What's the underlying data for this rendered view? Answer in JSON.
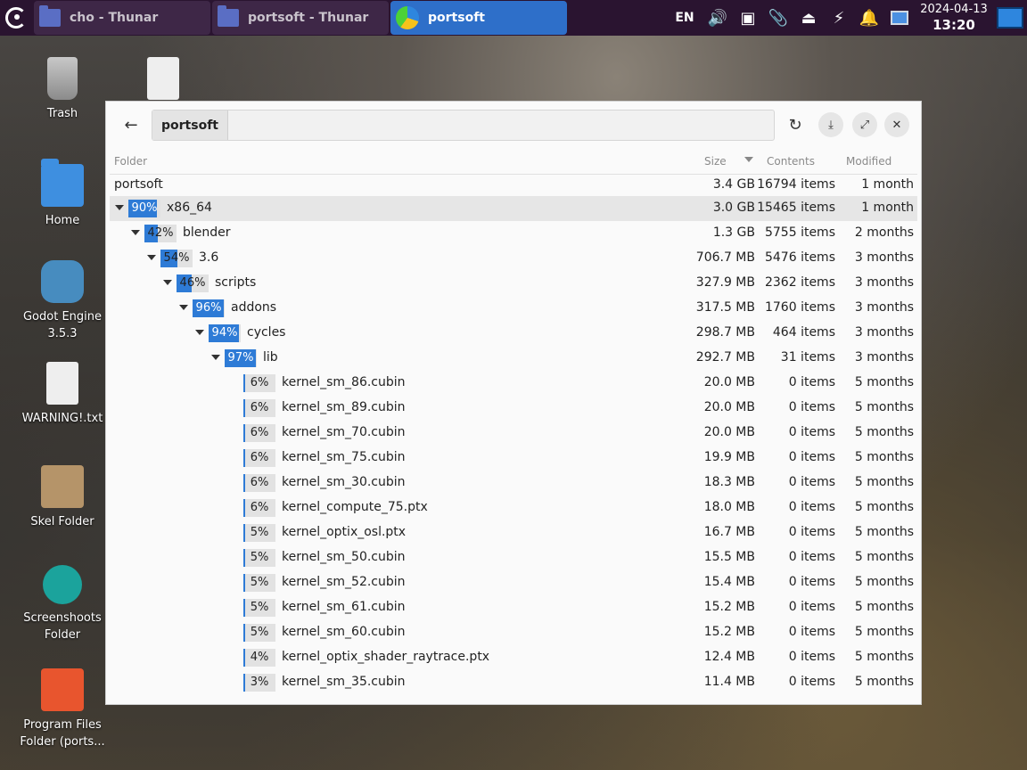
{
  "panel": {
    "tasks": [
      {
        "label": "cho - Thunar"
      },
      {
        "label": "portsoft - Thunar"
      },
      {
        "label": "portsoft"
      }
    ],
    "tray": {
      "language": "EN",
      "date": "2024-04-13",
      "time": "13:20"
    }
  },
  "desktop": {
    "icons": [
      {
        "label": "Trash"
      },
      {
        "label": "Home"
      },
      {
        "label": "Godot Engine 3.5.3"
      },
      {
        "label": "WARNING!.txt"
      },
      {
        "label": "Skel Folder"
      },
      {
        "label": "Screenshoots Folder"
      },
      {
        "label": "Program Files Folder (ports..."
      }
    ]
  },
  "window": {
    "path": "portsoft",
    "columns": {
      "folder": "Folder",
      "size": "Size",
      "contents": "Contents",
      "modified": "Modified"
    },
    "rows": [
      {
        "name": "portsoft",
        "size": "3.4 GB",
        "contents": "16794 items",
        "modified": "1 month"
      },
      {
        "pct": "90%",
        "name": "x86_64",
        "size": "3.0 GB",
        "contents": "15465 items",
        "modified": "1 month"
      },
      {
        "pct": "42%",
        "name": "blender",
        "size": "1.3 GB",
        "contents": "5755 items",
        "modified": "2 months"
      },
      {
        "pct": "54%",
        "name": "3.6",
        "size": "706.7 MB",
        "contents": "5476 items",
        "modified": "3 months"
      },
      {
        "pct": "46%",
        "name": "scripts",
        "size": "327.9 MB",
        "contents": "2362 items",
        "modified": "3 months"
      },
      {
        "pct": "96%",
        "name": "addons",
        "size": "317.5 MB",
        "contents": "1760 items",
        "modified": "3 months"
      },
      {
        "pct": "94%",
        "name": "cycles",
        "size": "298.7 MB",
        "contents": "464 items",
        "modified": "3 months"
      },
      {
        "pct": "97%",
        "name": "lib",
        "size": "292.7 MB",
        "contents": "31 items",
        "modified": "3 months"
      },
      {
        "pct": "6%",
        "name": "kernel_sm_86.cubin",
        "size": "20.0 MB",
        "contents": "0 items",
        "modified": "5 months"
      },
      {
        "pct": "6%",
        "name": "kernel_sm_89.cubin",
        "size": "20.0 MB",
        "contents": "0 items",
        "modified": "5 months"
      },
      {
        "pct": "6%",
        "name": "kernel_sm_70.cubin",
        "size": "20.0 MB",
        "contents": "0 items",
        "modified": "5 months"
      },
      {
        "pct": "6%",
        "name": "kernel_sm_75.cubin",
        "size": "19.9 MB",
        "contents": "0 items",
        "modified": "5 months"
      },
      {
        "pct": "6%",
        "name": "kernel_sm_30.cubin",
        "size": "18.3 MB",
        "contents": "0 items",
        "modified": "5 months"
      },
      {
        "pct": "6%",
        "name": "kernel_compute_75.ptx",
        "size": "18.0 MB",
        "contents": "0 items",
        "modified": "5 months"
      },
      {
        "pct": "5%",
        "name": "kernel_optix_osl.ptx",
        "size": "16.7 MB",
        "contents": "0 items",
        "modified": "5 months"
      },
      {
        "pct": "5%",
        "name": "kernel_sm_50.cubin",
        "size": "15.5 MB",
        "contents": "0 items",
        "modified": "5 months"
      },
      {
        "pct": "5%",
        "name": "kernel_sm_52.cubin",
        "size": "15.4 MB",
        "contents": "0 items",
        "modified": "5 months"
      },
      {
        "pct": "5%",
        "name": "kernel_sm_61.cubin",
        "size": "15.2 MB",
        "contents": "0 items",
        "modified": "5 months"
      },
      {
        "pct": "5%",
        "name": "kernel_sm_60.cubin",
        "size": "15.2 MB",
        "contents": "0 items",
        "modified": "5 months"
      },
      {
        "pct": "4%",
        "name": "kernel_optix_shader_raytrace.ptx",
        "size": "12.4 MB",
        "contents": "0 items",
        "modified": "5 months"
      },
      {
        "pct": "3%",
        "name": "kernel_sm_35.cubin",
        "size": "11.4 MB",
        "contents": "0 items",
        "modified": "5 months"
      }
    ]
  },
  "colors": {
    "accent": "#2e7bd6",
    "panel": "#2a1430"
  }
}
